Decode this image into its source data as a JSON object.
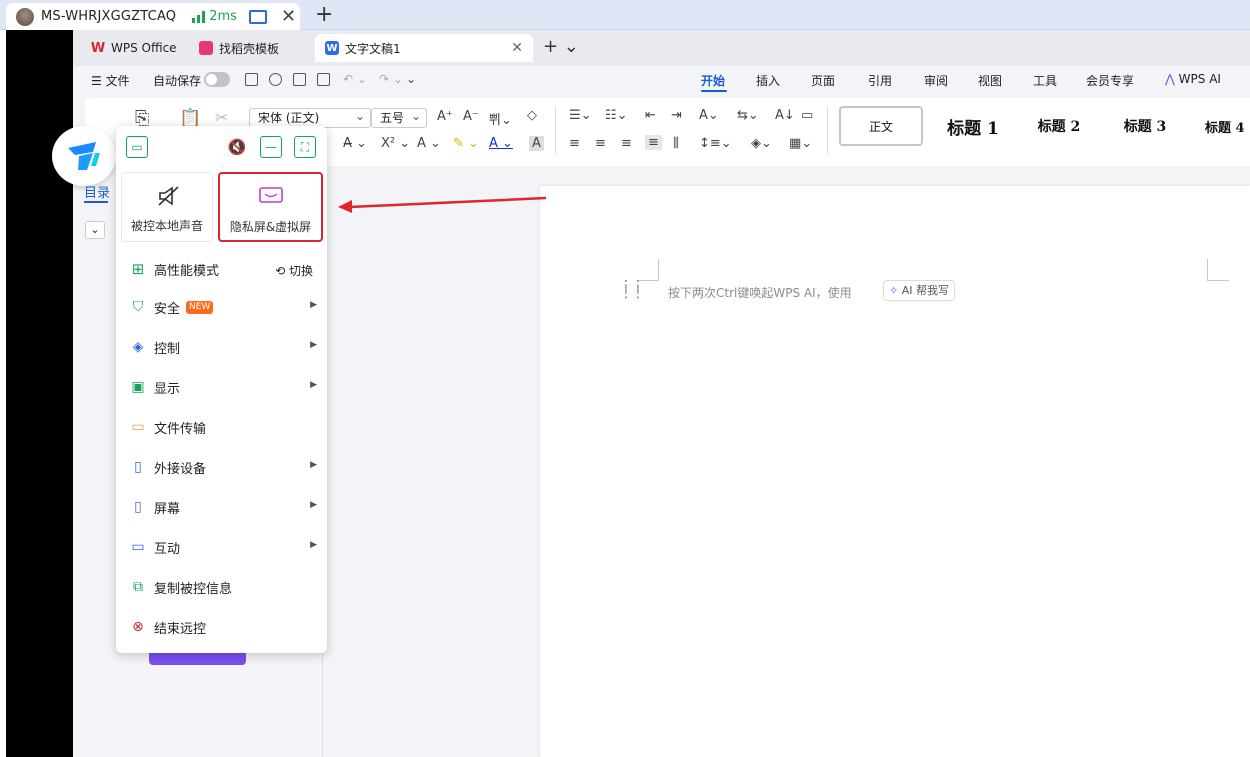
{
  "remote": {
    "machine_name": "MS-WHRJXGGZTCAQ",
    "latency": "2ms"
  },
  "wps_tabs": [
    {
      "label": "WPS Office"
    },
    {
      "label": "找稻壳模板"
    },
    {
      "label": "文字文稿1"
    }
  ],
  "menu": {
    "file": "文件",
    "autosave": "自动保存"
  },
  "ribbon_tabs": [
    "开始",
    "插入",
    "页面",
    "引用",
    "审阅",
    "视图",
    "工具",
    "会员专享",
    "WPS AI"
  ],
  "ribbon": {
    "font_name": "宋体 (正文)",
    "font_size": "五号",
    "styles": [
      "正文",
      "标题 1",
      "标题 2",
      "标题 3",
      "标题 4"
    ]
  },
  "nav": {
    "title": "目录"
  },
  "document": {
    "hint": "按下两次Ctrl键唤起WPS AI，使用",
    "ai_chip": "AI 帮我写"
  },
  "panel": {
    "big_buttons": [
      {
        "label": "被控本地声音",
        "icon": "speaker-muted-icon"
      },
      {
        "label": "隐私屏&虚拟屏",
        "icon": "privacy-screen-icon"
      }
    ],
    "high_perf": "高性能模式",
    "switch": "切换",
    "items": [
      {
        "label": "安全",
        "badge": "NEW",
        "icon": "shield-icon"
      },
      {
        "label": "控制",
        "icon": "layers-icon"
      },
      {
        "label": "显示",
        "icon": "display-icon"
      },
      {
        "label": "文件传输",
        "icon": "folder-icon"
      },
      {
        "label": "外接设备",
        "icon": "external-device-icon"
      },
      {
        "label": "屏幕",
        "icon": "screen-icon"
      },
      {
        "label": "互动",
        "icon": "interaction-icon"
      },
      {
        "label": "复制被控信息",
        "icon": "copy-icon"
      },
      {
        "label": "结束远控",
        "icon": "close-circle-icon"
      }
    ]
  },
  "colors": {
    "accent_blue": "#1b5bd6",
    "highlight_red": "#d8272d",
    "panel_green": "#1aa35a",
    "latency_green": "#1ba34d",
    "new_badge": "#ff6a1a"
  }
}
